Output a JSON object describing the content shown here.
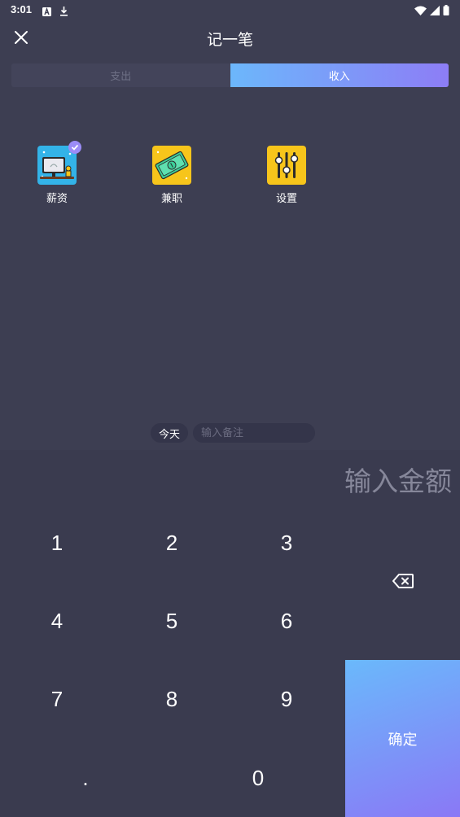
{
  "status_bar": {
    "time": "3:01",
    "left_icons": [
      "text-a-icon",
      "download-icon"
    ],
    "right_icons": [
      "wifi-icon",
      "signal-icon",
      "battery-icon"
    ]
  },
  "header": {
    "title": "记一笔",
    "close_icon": "close-icon"
  },
  "tabs": [
    {
      "label": "支出",
      "active": false
    },
    {
      "label": "收入",
      "active": true
    }
  ],
  "categories": [
    {
      "label": "薪资",
      "icon": "salary-monitor-icon",
      "selected": true
    },
    {
      "label": "兼职",
      "icon": "parttime-money-icon",
      "selected": false
    },
    {
      "label": "设置",
      "icon": "settings-sliders-icon",
      "selected": false
    }
  ],
  "memo": {
    "date_label": "今天",
    "placeholder": "输入备注"
  },
  "amount": {
    "placeholder": "输入金额"
  },
  "keypad": {
    "keys": [
      "1",
      "2",
      "3",
      "4",
      "5",
      "6",
      "7",
      "8",
      "9",
      ".",
      "0"
    ],
    "backspace_icon": "backspace-icon",
    "confirm_label": "确定"
  },
  "colors": {
    "background": "#3d3e52",
    "keypad_background": "#3a3b4f",
    "accent_start": "#6cb7fb",
    "accent_end": "#8d7df6",
    "category_yellow": "#f7c51b",
    "category_blue": "#33b3e8"
  }
}
